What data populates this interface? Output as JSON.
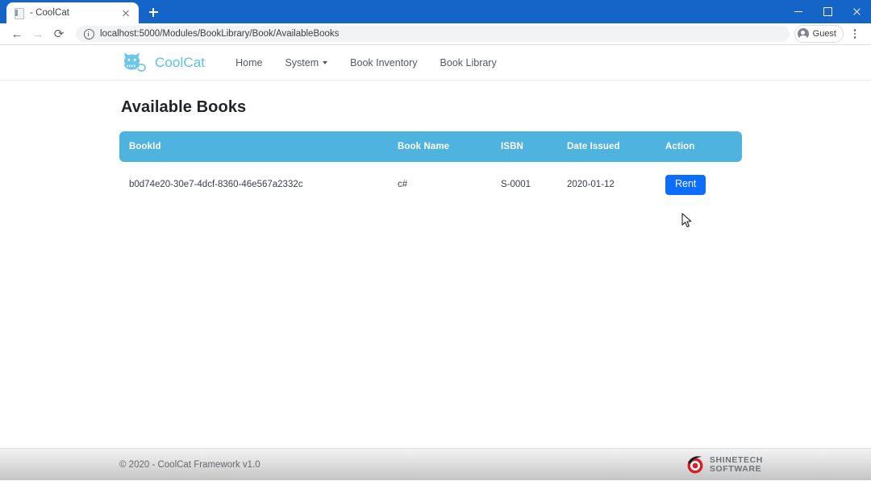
{
  "browser": {
    "tab": {
      "title": "- CoolCat",
      "favicon": "page-icon",
      "close_label": "×"
    },
    "new_tab_label": "+",
    "window_controls": {
      "minimize": "—",
      "maximize": "□",
      "close": "×"
    },
    "toolbar": {
      "back": "←",
      "forward": "→",
      "reload": "⟳",
      "site_info_icon": "info-icon",
      "url": "localhost:5000/Modules/BookLibrary/Book/AvailableBooks",
      "profile_label": "Guest",
      "menu_icon": "kebab-menu-icon"
    }
  },
  "site": {
    "brand": {
      "name": "CoolCat",
      "logo_icon": "coolcat-logo-icon",
      "color": "#5bc0e8"
    },
    "nav": [
      {
        "label": "Home",
        "has_caret": false
      },
      {
        "label": "System",
        "has_caret": true
      },
      {
        "label": "Book Inventory",
        "has_caret": false
      },
      {
        "label": "Book Library",
        "has_caret": false
      }
    ]
  },
  "main": {
    "page_title": "Available Books",
    "table": {
      "header_color": "#4fb3e0",
      "columns": [
        "BookId",
        "Book Name",
        "ISBN",
        "Date Issued",
        "Action"
      ],
      "rows": [
        {
          "bookid": "b0d74e20-30e7-4dcf-8360-46e567a2332c",
          "book_name": "c#",
          "isbn": "S-0001",
          "date_issued": "2020-01-12",
          "action_label": "Rent",
          "action_color": "#0d6efd"
        }
      ]
    }
  },
  "footer": {
    "copyright": "© 2020 - CoolCat Framework v1.0",
    "logo": {
      "line1": "SHINETECH",
      "line2": "SOFTWARE",
      "mark_icon": "shinetech-target-icon",
      "mark_color": "#d42027"
    }
  }
}
